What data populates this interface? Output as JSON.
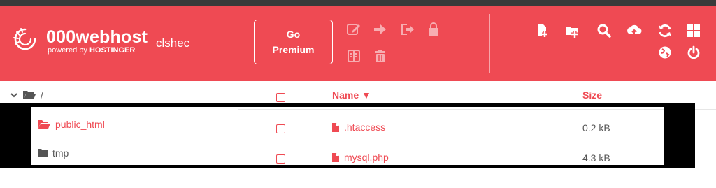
{
  "brand": {
    "name": "000webhost",
    "tagline_prefix": "powered by",
    "tagline_brand": "HOSTINGER"
  },
  "user": {
    "name": "clshec"
  },
  "premium": {
    "line1": "Go",
    "line2": "Premium"
  },
  "toolbar": {
    "left_icons": [
      "edit-icon",
      "move-icon",
      "export-icon",
      "lock-icon",
      "archive-icon",
      "trash-icon"
    ],
    "right_icons": [
      "new-file-icon",
      "new-folder-icon",
      "search-icon",
      "upload-icon",
      "refresh-icon",
      "grid-icon",
      "globe-icon",
      "power-icon"
    ]
  },
  "tree": {
    "root_label": "/",
    "items": [
      {
        "label": "public_html",
        "color": "#ef4a53"
      },
      {
        "label": "tmp",
        "color": "#555555"
      }
    ]
  },
  "table": {
    "columns": {
      "name": "Name ▼",
      "size": "Size"
    },
    "rows": [
      {
        "name": ".htaccess",
        "size": "0.2 kB"
      },
      {
        "name": "mysql.php",
        "size": "4.3 kB"
      }
    ]
  },
  "colors": {
    "accent": "#ef4a53",
    "topstrip": "#3a3a3a",
    "mask": "#000000"
  }
}
